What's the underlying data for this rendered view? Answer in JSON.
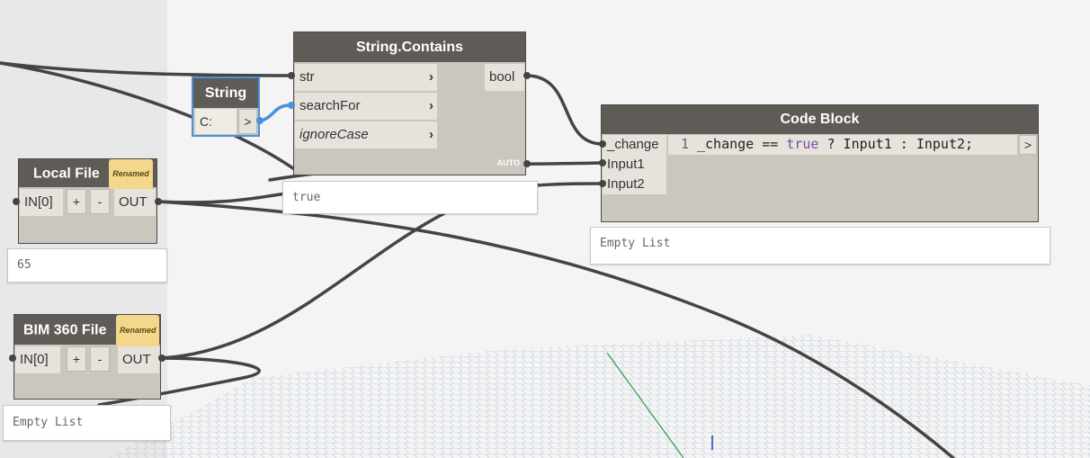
{
  "nodes": {
    "string_contains": {
      "title": "String.Contains",
      "inputs": [
        "str",
        "searchFor",
        "ignoreCase"
      ],
      "output": "bool",
      "lacing": "AUTO",
      "preview": "true"
    },
    "string": {
      "title": "String",
      "value": "C:",
      "output_arrow": ">"
    },
    "local_file": {
      "title": "Local File",
      "badge": "Renamed",
      "input": "IN[0]",
      "add_btn": "+",
      "remove_btn": "-",
      "output": "OUT",
      "preview": "65"
    },
    "bim360_file": {
      "title": "BIM 360 File",
      "badge": "Renamed",
      "input": "IN[0]",
      "add_btn": "+",
      "remove_btn": "-",
      "output": "OUT",
      "preview": "Empty List"
    },
    "code_block": {
      "title": "Code Block",
      "inputs": [
        "_change",
        "Input1",
        "Input2"
      ],
      "line_number": "1",
      "code_pre": "_change == ",
      "code_kw": "true",
      "code_post": " ? Input1 : Input2;",
      "output_arrow": ">",
      "preview": "Empty List"
    }
  },
  "colors": {
    "wire": "#444444",
    "selected_wire": "#4a90d9",
    "node_header": "#5f5b57",
    "node_body": "#cbc6be",
    "keyword": "#7a4aa8"
  }
}
